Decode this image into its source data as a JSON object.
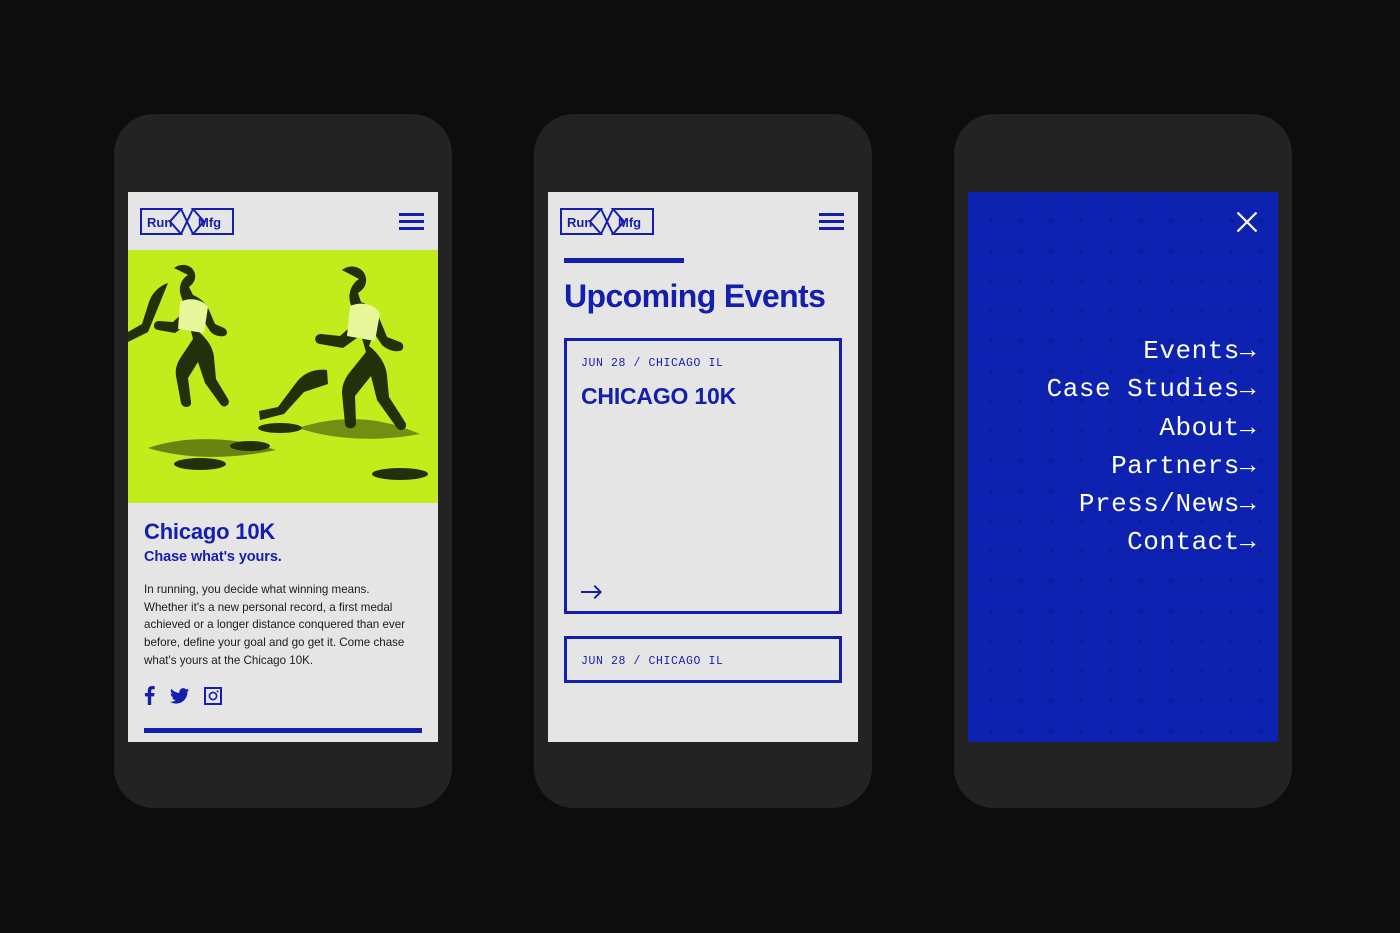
{
  "colors": {
    "page_background": "#0d0d0e",
    "phone_frame": "#232324",
    "screen_background": "#e5e5e5",
    "brand_blue": "#141fad",
    "menu_blue": "#0d22b0",
    "accent_lime": "#c2ec1c",
    "body_text": "#1b1b1b",
    "white": "#ffffff"
  },
  "brand": {
    "logo_left": "Run",
    "logo_right": "Mfg",
    "logo_divider_icon": "x-cross-icon",
    "menu_icon": "hamburger-icon"
  },
  "phone_one": {
    "hero": {
      "image_alt": "two-runners-duotone",
      "background_color": "#c2ec1c"
    },
    "article": {
      "title": "Chicago 10K",
      "subtitle": "Chase what's yours.",
      "body": "In running, you decide what winning means. Whether it's a new personal record, a first medal achieved or a longer distance conquered than ever before, define your goal and go get it. Come chase what's yours at the Chicago 10K."
    },
    "social": [
      {
        "name": "facebook-icon",
        "label": "Facebook"
      },
      {
        "name": "twitter-icon",
        "label": "Twitter"
      },
      {
        "name": "instagram-icon",
        "label": "Instagram"
      }
    ]
  },
  "phone_two": {
    "section_title": "Upcoming Events",
    "events": [
      {
        "meta": "JUN 28 / CHICAGO IL",
        "name": "CHICAGO 10K",
        "arrow_icon": "arrow-right-icon"
      },
      {
        "meta": "JUN 28 / CHICAGO IL",
        "name": "",
        "arrow_icon": "arrow-right-icon"
      }
    ]
  },
  "phone_three": {
    "close_icon": "close-icon",
    "menu_items": [
      {
        "label": "Events→"
      },
      {
        "label": "Case Studies→"
      },
      {
        "label": "About→"
      },
      {
        "label": "Partners→"
      },
      {
        "label": "Press/News→"
      },
      {
        "label": "Contact→"
      }
    ]
  }
}
